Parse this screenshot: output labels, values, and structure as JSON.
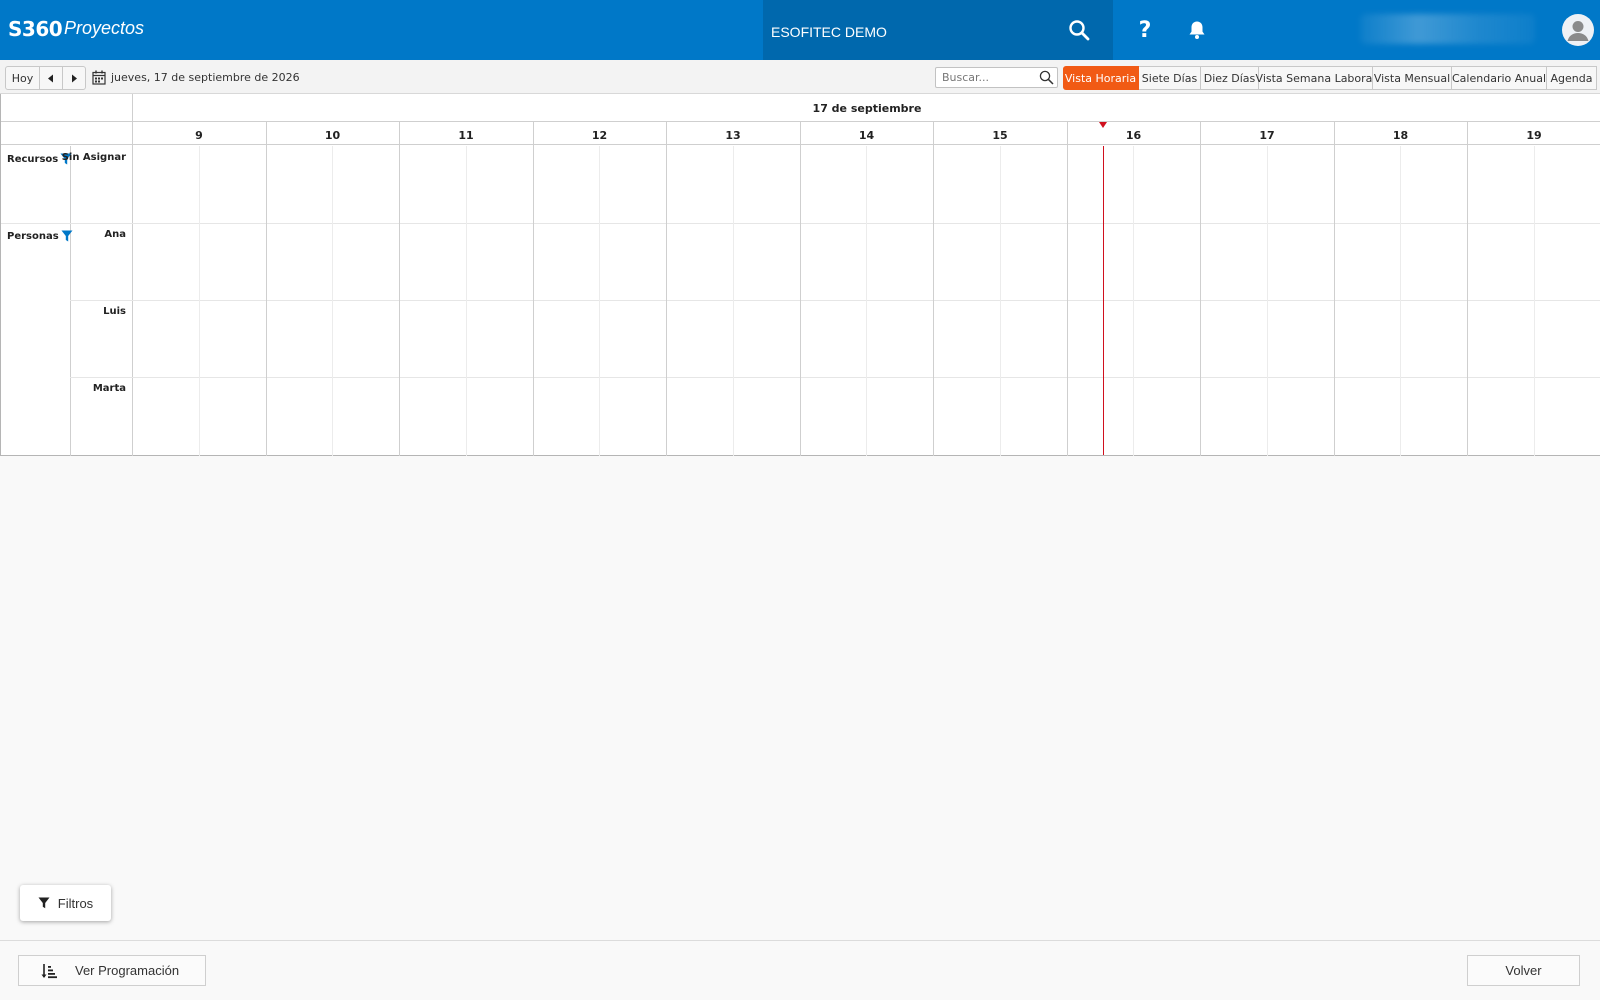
{
  "header": {
    "brand": "S360",
    "module": "Proyectos",
    "company": "ESOFITEC DEMO",
    "bg_color": "#0078c8"
  },
  "toolbar": {
    "today_label": "Hoy",
    "current_date": "jueves, 17 de septiembre de 2026",
    "search_placeholder": "Buscar...",
    "views": [
      "Vista Horaria",
      "Siete Días",
      "Diez Días",
      "Vista Semana Laboral",
      "Vista Mensual",
      "Calendario Anual",
      "Agenda"
    ],
    "active_view": "Vista Horaria",
    "active_color": "#f15a14"
  },
  "scheduler": {
    "date_header": "17 de septiembre",
    "hours": [
      "9",
      "10",
      "11",
      "12",
      "13",
      "14",
      "15",
      "16",
      "17",
      "18",
      "19"
    ],
    "groups": [
      {
        "label": "Recursos",
        "resources": [
          "Sin Asignar"
        ]
      },
      {
        "label": "Personas",
        "resources": [
          "Ana",
          "Luis",
          "Marta"
        ]
      }
    ],
    "now_line_color": "#d0101e"
  },
  "bottom": {
    "filters_label": "Filtros",
    "schedule_label": "Ver Programación",
    "back_label": "Volver"
  }
}
